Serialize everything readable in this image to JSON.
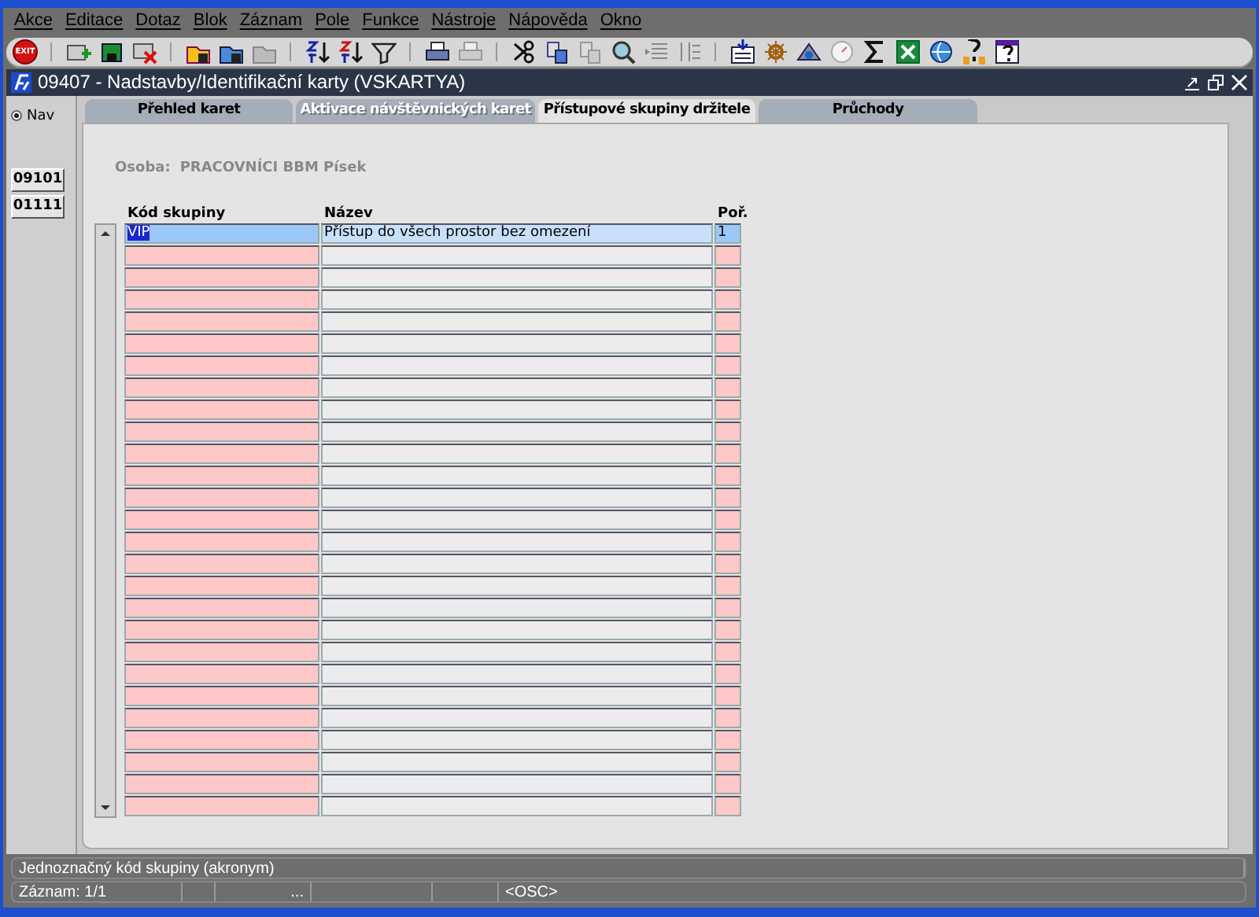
{
  "menu": [
    "Akce",
    "Editace",
    "Dotaz",
    "Blok",
    "Záznam",
    "Pole",
    "Funkce",
    "Nástroje",
    "Nápověda",
    "Okno"
  ],
  "toolbar": {
    "exit_label": "EXIT"
  },
  "window": {
    "title": "09407 - Nadstavby/Identifikační karty (VSKARTYA)"
  },
  "nav": {
    "radio": {
      "label": "Nav",
      "checked": true
    },
    "buttons": [
      "09101",
      "01111"
    ]
  },
  "tabs": [
    {
      "label": "Přehled karet",
      "selected": false,
      "disabled": false
    },
    {
      "label": "Aktivace návštěvnických karet",
      "selected": false,
      "disabled": true
    },
    {
      "label": "Přístupové skupiny držitele",
      "selected": true,
      "disabled": false
    },
    {
      "label": "Průchody",
      "selected": false,
      "disabled": false
    }
  ],
  "person": {
    "label": "Osoba:",
    "value": "PRACOVNÍCI BBM Písek"
  },
  "table": {
    "columns": [
      "Kód skupiny",
      "Název",
      "Poř."
    ],
    "rows": [
      {
        "code": "VIP",
        "name": "Přístup do všech prostor bez omezení",
        "order": "1",
        "selected": true
      }
    ]
  },
  "status_bar": {
    "hint": "Jednoznačný kód skupiny (akronym)",
    "record": "Záznam: 1/1",
    "field_3": "...",
    "mode": "<OSC>"
  }
}
